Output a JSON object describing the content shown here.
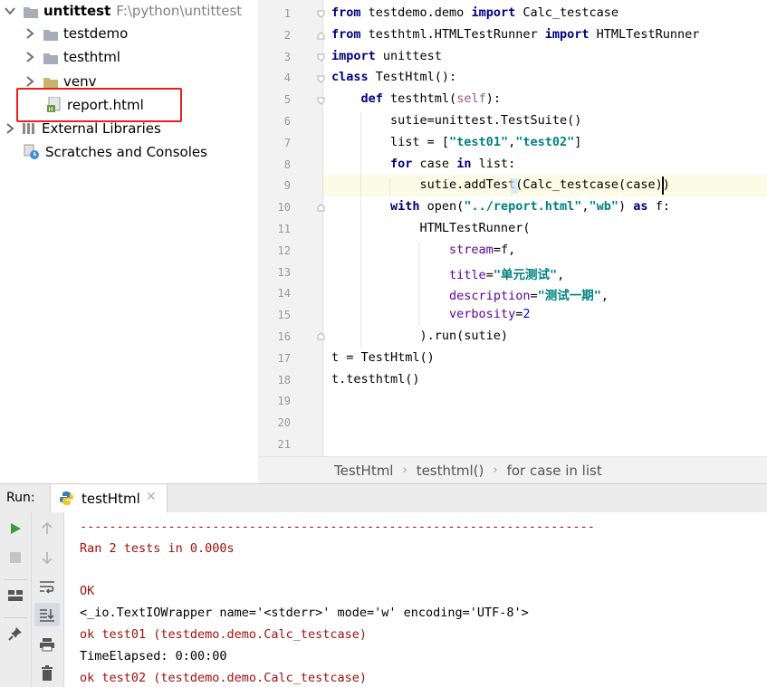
{
  "project_tree": {
    "root_label": "untittest",
    "root_path": "F:\\python\\untittest",
    "items": [
      {
        "label": "testdemo"
      },
      {
        "label": "testhtml"
      },
      {
        "label": "venv"
      },
      {
        "label": "report.html"
      },
      {
        "label": "External Libraries"
      },
      {
        "label": "Scratches and Consoles"
      }
    ]
  },
  "editor": {
    "line_numbers": [
      "1",
      "2",
      "3",
      "4",
      "5",
      "6",
      "7",
      "8",
      "9",
      "10",
      "11",
      "12",
      "13",
      "14",
      "15",
      "16",
      "17",
      "18",
      "19",
      "20",
      "21"
    ],
    "lines": [
      [
        {
          "t": "from",
          "c": "kw"
        },
        {
          "t": " testdemo.demo ",
          "c": "gray"
        },
        {
          "t": "import",
          "c": "kw"
        },
        {
          "t": " Calc_testcase",
          "c": "gray"
        }
      ],
      [
        {
          "t": "from",
          "c": "kw"
        },
        {
          "t": " testhtml.HTMLTestRunner ",
          "c": "gray"
        },
        {
          "t": "import",
          "c": "kw"
        },
        {
          "t": " HTMLTestRunner",
          "c": "gray"
        }
      ],
      [
        {
          "t": "import",
          "c": "kw"
        },
        {
          "t": " unittest",
          "c": "gray"
        }
      ],
      [
        {
          "t": "class",
          "c": "kw"
        },
        {
          "t": " TestHtml():",
          "c": "gray"
        }
      ],
      [
        {
          "t": "    ",
          "c": "gray"
        },
        {
          "t": "def",
          "c": "kw"
        },
        {
          "t": " testhtml(",
          "c": "gray"
        },
        {
          "t": "self",
          "c": "slf"
        },
        {
          "t": "):",
          "c": "gray"
        }
      ],
      [
        {
          "t": "        sutie=unittest.TestSuite()",
          "c": "gray"
        }
      ],
      [
        {
          "t": "        list = [",
          "c": "gray"
        },
        {
          "t": "\"test01\"",
          "c": "str"
        },
        {
          "t": ",",
          "c": "gray"
        },
        {
          "t": "\"test02\"",
          "c": "str"
        },
        {
          "t": "]",
          "c": "gray"
        }
      ],
      [
        {
          "t": "        ",
          "c": "gray"
        },
        {
          "t": "for",
          "c": "kw"
        },
        {
          "t": " case ",
          "c": "gray"
        },
        {
          "t": "in",
          "c": "kw"
        },
        {
          "t": " list:",
          "c": "gray"
        }
      ],
      [
        {
          "t": "            sutie.addTest(Calc_testcase(case))",
          "c": "gray"
        }
      ],
      [
        {
          "t": "        ",
          "c": "gray"
        },
        {
          "t": "with",
          "c": "kw"
        },
        {
          "t": " open(",
          "c": "gray"
        },
        {
          "t": "\"../report.html\"",
          "c": "str"
        },
        {
          "t": ",",
          "c": "gray"
        },
        {
          "t": "\"wb\"",
          "c": "str"
        },
        {
          "t": ") ",
          "c": "gray"
        },
        {
          "t": "as",
          "c": "kw"
        },
        {
          "t": " f:",
          "c": "gray"
        }
      ],
      [
        {
          "t": "            HTMLTestRunner(",
          "c": "gray"
        }
      ],
      [
        {
          "t": "                ",
          "c": "gray"
        },
        {
          "t": "stream",
          "c": "prm"
        },
        {
          "t": "=f,",
          "c": "gray"
        }
      ],
      [
        {
          "t": "                ",
          "c": "gray"
        },
        {
          "t": "title",
          "c": "prm"
        },
        {
          "t": "=",
          "c": "gray"
        },
        {
          "t": "\"单元测试\"",
          "c": "str"
        },
        {
          "t": ",",
          "c": "gray"
        }
      ],
      [
        {
          "t": "                ",
          "c": "gray"
        },
        {
          "t": "description",
          "c": "prm"
        },
        {
          "t": "=",
          "c": "gray"
        },
        {
          "t": "\"测试一期\"",
          "c": "str"
        },
        {
          "t": ",",
          "c": "gray"
        }
      ],
      [
        {
          "t": "                ",
          "c": "gray"
        },
        {
          "t": "verbosity",
          "c": "prm"
        },
        {
          "t": "=",
          "c": "gray"
        },
        {
          "t": "2",
          "c": "num"
        }
      ],
      [
        {
          "t": "            ).run(sutie)",
          "c": "gray"
        }
      ],
      [
        {
          "t": "t = TestHtml()",
          "c": "gray"
        }
      ],
      [
        {
          "t": "t.testhtml()",
          "c": "gray"
        }
      ],
      [],
      [],
      []
    ]
  },
  "breadcrumb": [
    "TestHtml",
    "testhtml()",
    "for case in list"
  ],
  "run_panel": {
    "label": "Run:",
    "tab_label": "testHtml",
    "console_lines": [
      {
        "text": "----------------------------------------------------------------------",
        "style": "red"
      },
      {
        "text": "Ran 2 tests in 0.000s",
        "style": "red"
      },
      {
        "text": "",
        "style": "red"
      },
      {
        "text": "OK",
        "style": "red"
      },
      {
        "text": "<_io.TextIOWrapper name='<stderr>' mode='w' encoding='UTF-8'>",
        "style": "blk"
      },
      {
        "text": "ok test01 (testdemo.demo.Calc_testcase)",
        "style": "red"
      },
      {
        "text": "TimeElapsed: 0:00:00",
        "style": "blk"
      },
      {
        "text": "ok test02 (testdemo.demo.Calc_testcase)",
        "style": "red"
      }
    ]
  },
  "colors": {
    "highlight_box": "#e8201e",
    "keyword": "#000080",
    "string": "#008080",
    "param": "#660099",
    "console_error": "#a01010"
  }
}
